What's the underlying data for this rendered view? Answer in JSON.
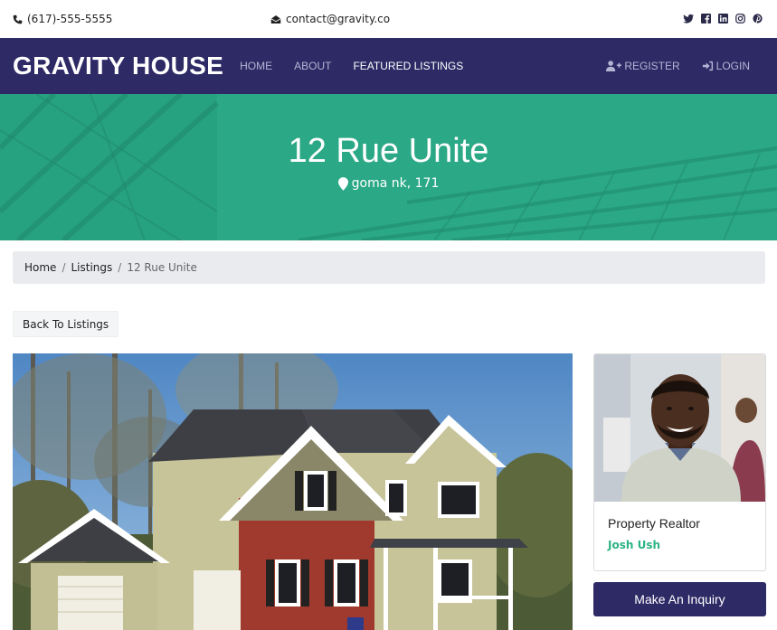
{
  "topbar": {
    "phone": "(617)-555-5555",
    "email": "contact@gravity.co",
    "social_icons": [
      "twitter-icon",
      "facebook-icon",
      "linkedin-icon",
      "instagram-icon",
      "pinterest-icon"
    ]
  },
  "navbar": {
    "brand": "GRAVITY HOUSE",
    "links": [
      "HOME",
      "ABOUT",
      "FEATURED LISTINGS"
    ],
    "active_link": "FEATURED LISTINGS",
    "register": "REGISTER",
    "login": "LOGIN"
  },
  "hero": {
    "title": "12 Rue Unite",
    "address": "goma nk, 171"
  },
  "breadcrumb": [
    "Home",
    "Listings",
    "12 Rue Unite"
  ],
  "back_button": "Back To Listings",
  "realtor": {
    "role": "Property Realtor",
    "name": "Josh Ush"
  },
  "inquiry_button": "Make An Inquiry",
  "colors": {
    "nav_bg": "#2e2a66",
    "hero_bg": "#2aa985",
    "accent_green": "#2db383"
  }
}
